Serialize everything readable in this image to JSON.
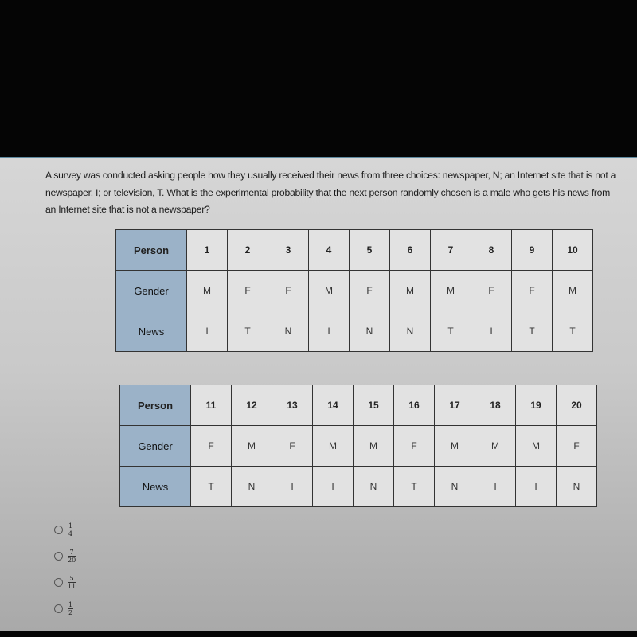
{
  "question": "A survey was conducted asking people how they usually received their news from three choices: newspaper, N; an Internet site that is not a newspaper, I; or television, T. What is the experimental probability that the next person randomly chosen is a male who gets his news from an Internet site that is not a newspaper?",
  "tables": [
    {
      "row_labels": [
        "Person",
        "Gender",
        "News"
      ],
      "person": [
        "1",
        "2",
        "3",
        "4",
        "5",
        "6",
        "7",
        "8",
        "9",
        "10"
      ],
      "gender": [
        "M",
        "F",
        "F",
        "M",
        "F",
        "M",
        "M",
        "F",
        "F",
        "M"
      ],
      "news": [
        "I",
        "T",
        "N",
        "I",
        "N",
        "N",
        "T",
        "I",
        "T",
        "T"
      ]
    },
    {
      "row_labels": [
        "Person",
        "Gender",
        "News"
      ],
      "person": [
        "11",
        "12",
        "13",
        "14",
        "15",
        "16",
        "17",
        "18",
        "19",
        "20"
      ],
      "gender": [
        "F",
        "M",
        "F",
        "M",
        "M",
        "F",
        "M",
        "M",
        "M",
        "F"
      ],
      "news": [
        "T",
        "N",
        "I",
        "I",
        "N",
        "T",
        "N",
        "I",
        "I",
        "N"
      ]
    }
  ],
  "answers": [
    {
      "numerator": "1",
      "denominator": "4",
      "selected": false
    },
    {
      "numerator": "7",
      "denominator": "20",
      "selected": false
    },
    {
      "numerator": "5",
      "denominator": "11",
      "selected": false
    },
    {
      "numerator": "1",
      "denominator": "2",
      "selected": false
    }
  ],
  "colors": {
    "header_cell": "#9bb2c8",
    "cell": "#e2e2e2",
    "screen_top_accent": "#5f8aa0"
  }
}
